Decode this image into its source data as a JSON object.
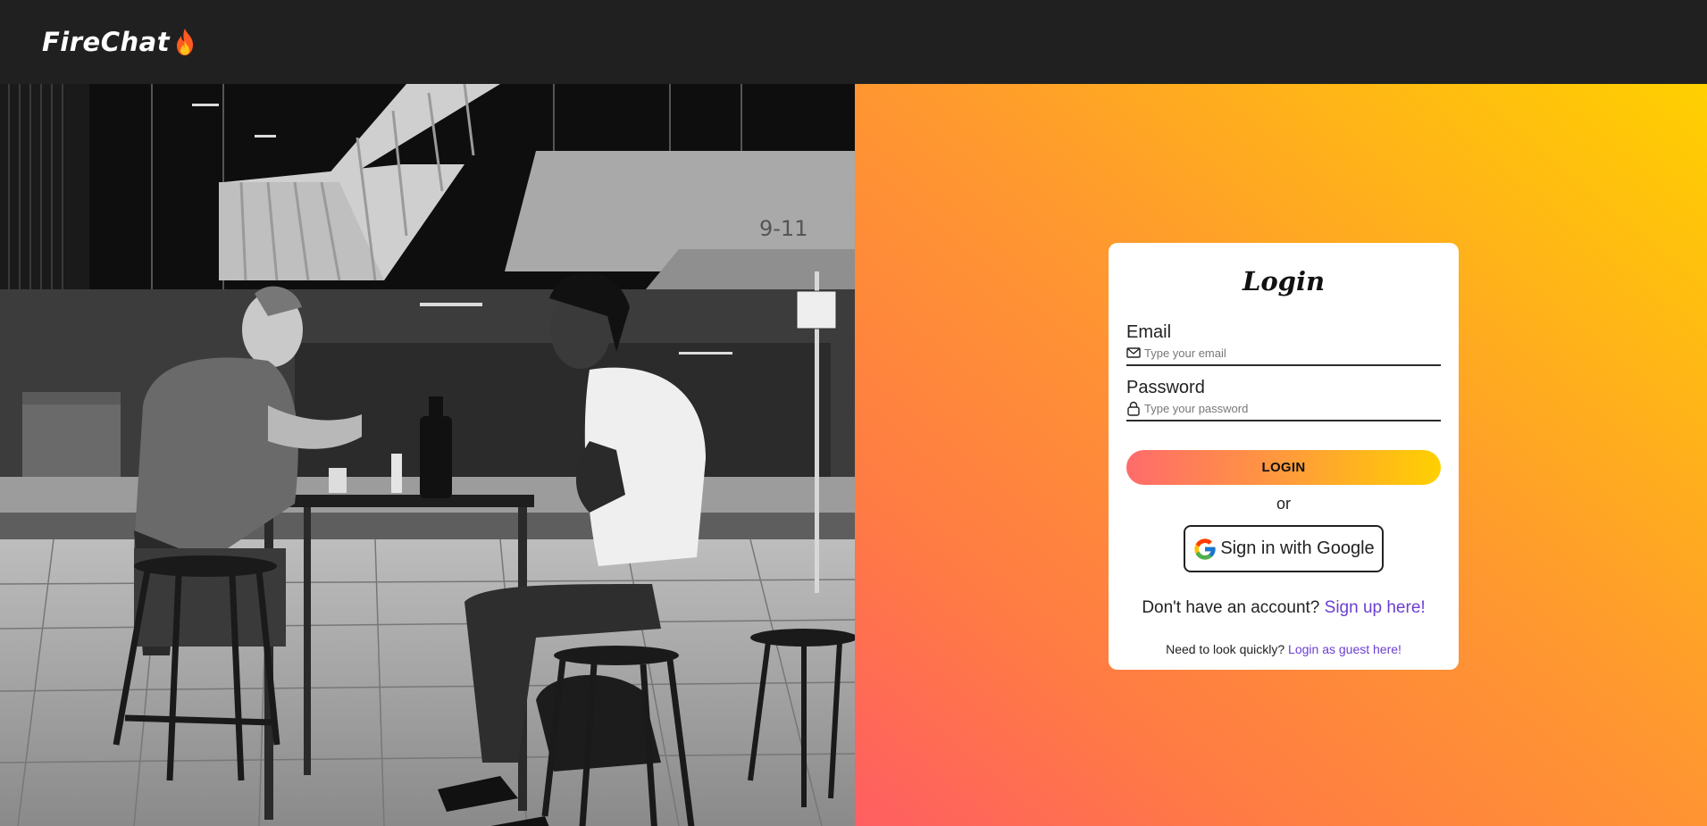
{
  "navbar": {
    "brand": "FireChat"
  },
  "hero_image": {
    "alt": "Two men talking at an outdoor cafe table"
  },
  "login": {
    "title": "Login",
    "email_label": "Email",
    "email_placeholder": "Type your email",
    "password_label": "Password",
    "password_placeholder": "Type your password",
    "login_button": "LOGIN",
    "or_text": "or",
    "google_button": "Sign in with Google",
    "signup_prompt": "Don't have an account?",
    "signup_link": "Sign up here!",
    "guest_prompt": "Need to look quickly?",
    "guest_link": "Login as guest here!"
  },
  "colors": {
    "navbar_bg": "#202020",
    "link": "#6b3fd1",
    "gradient_start": "#ff5e62",
    "gradient_end": "#ffd000"
  }
}
